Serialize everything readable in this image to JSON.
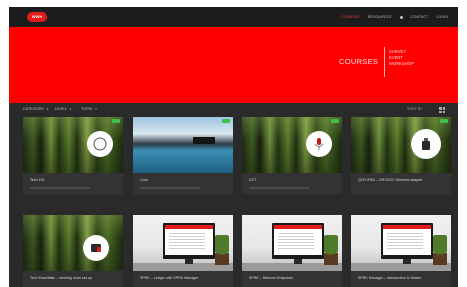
{
  "nav": {
    "logo": "WWH",
    "items": [
      "COURSES",
      "RESOURCES",
      "CONTACT",
      "LOGIN"
    ]
  },
  "hero": {
    "title": "COURSES",
    "tags": [
      "SURVEY",
      "EVENT",
      "WORKSHOP"
    ]
  },
  "filters": [
    "CATEGORY",
    "LEVEL",
    "TOPIC"
  ],
  "sort_label": "SORT BY",
  "cards": [
    {
      "title": "Tech 101"
    },
    {
      "title": "Core"
    },
    {
      "title": "DCT"
    },
    {
      "title": "QCR IPAD – DRYDOC Wireless adapter"
    },
    {
      "title": "Tech Essentials – meeting room set up"
    },
    {
      "title": "SPRK – Ledger with SPRK Manager"
    },
    {
      "title": "SPRK – Network Endpoints"
    },
    {
      "title": "SPRK Manager – Introduction to Maxim"
    }
  ],
  "colors": {
    "brand_red": "#ff0000",
    "accent_green": "#3cc24a",
    "background_dark": "#2a2a2a"
  }
}
